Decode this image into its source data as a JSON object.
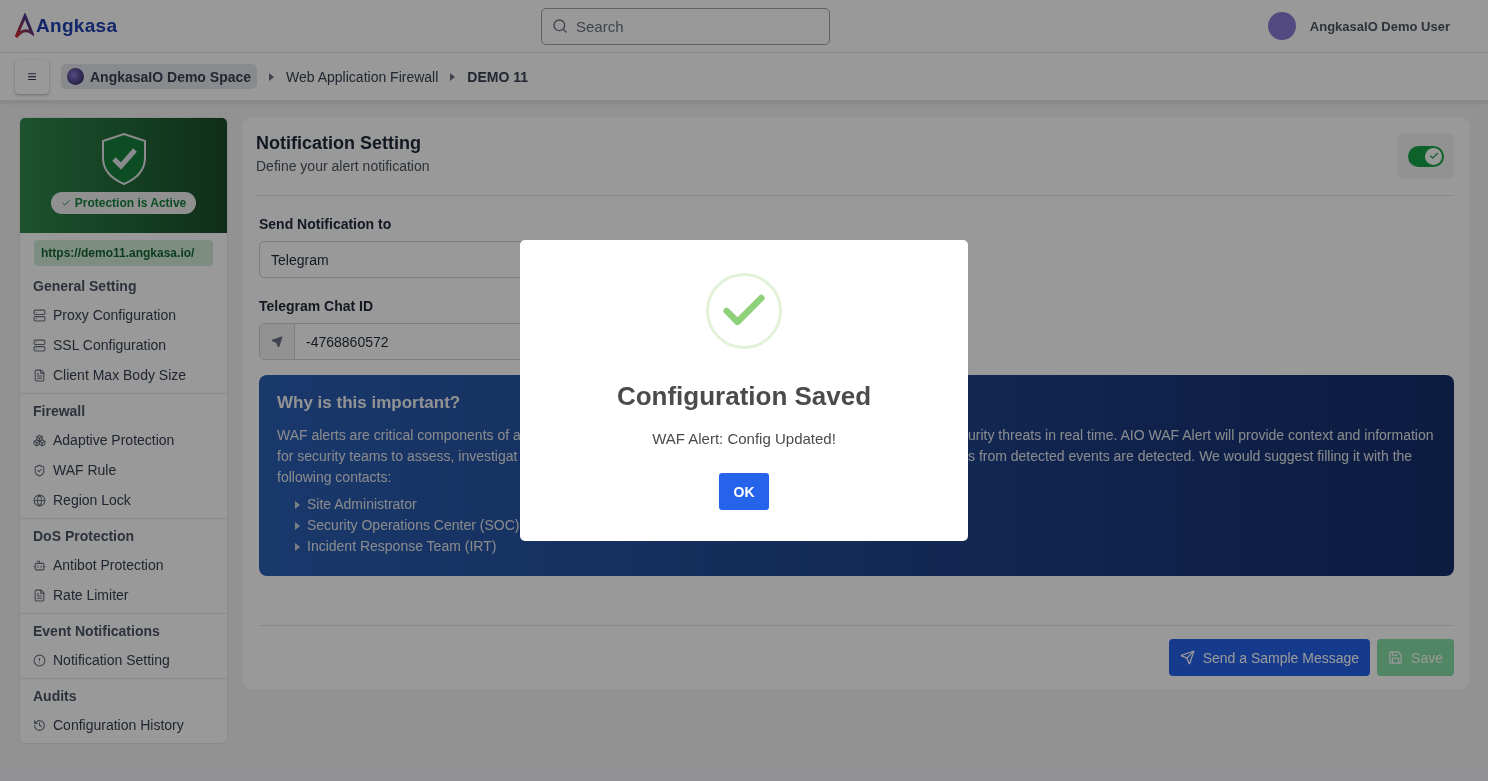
{
  "header": {
    "logo": "Angkasa",
    "search": {
      "placeholder": "Search"
    },
    "user": "AngkasaIO Demo User"
  },
  "breadcrumb": {
    "menu_icon": "≡",
    "items": [
      {
        "label": "AngkasaIO Demo Space",
        "kind": "space"
      },
      {
        "label": "Web Application Firewall",
        "kind": "link"
      },
      {
        "label": "DEMO 11",
        "kind": "current"
      }
    ]
  },
  "sidebar": {
    "status": "Protection is Active",
    "url": "https://demo11.angkasa.io/",
    "sections": [
      {
        "title": "General Setting",
        "items": [
          "Proxy Configuration",
          "SSL Configuration",
          "Client Max Body Size"
        ]
      },
      {
        "title": "Firewall",
        "items": [
          "Adaptive Protection",
          "WAF Rule",
          "Region Lock"
        ]
      },
      {
        "title": "DoS Protection",
        "items": [
          "Antibot Protection",
          "Rate Limiter"
        ]
      },
      {
        "title": "Event Notifications",
        "items": [
          "Notification Setting"
        ]
      },
      {
        "title": "Audits",
        "items": [
          "Configuration History"
        ]
      }
    ]
  },
  "panel": {
    "title": "Notification Setting",
    "subtitle": "Define your alert notification",
    "toggle": {
      "on": true
    },
    "fields": [
      {
        "label": "Send Notification to",
        "value": "Telegram",
        "kind": "select"
      },
      {
        "label": "Telegram Chat ID",
        "value": "-4768860572",
        "kind": "icon_input"
      }
    ],
    "info": {
      "title": "Why is this important?",
      "lines": [
        {
          "left": "WAF alerts are critical components of a",
          "right": "urity threats in real time. AIO WAF Alert will provide context and information"
        },
        {
          "left": "for security teams to assess, investigat",
          "right": "s from detected events are detected. We would suggest filling it with the"
        },
        {
          "left": "following contacts:"
        }
      ],
      "contacts": [
        "Site Administrator",
        "Security Operations Center (SOC)",
        "Incident Response Team (IRT)"
      ]
    },
    "buttons": [
      {
        "label": "Send a Sample Message",
        "kind": "send",
        "disabled": false
      },
      {
        "label": "Save",
        "kind": "save",
        "disabled": true
      }
    ]
  },
  "dialog": {
    "title": "Configuration Saved",
    "message": "WAF Alert: Config Updated!",
    "button": "OK"
  }
}
